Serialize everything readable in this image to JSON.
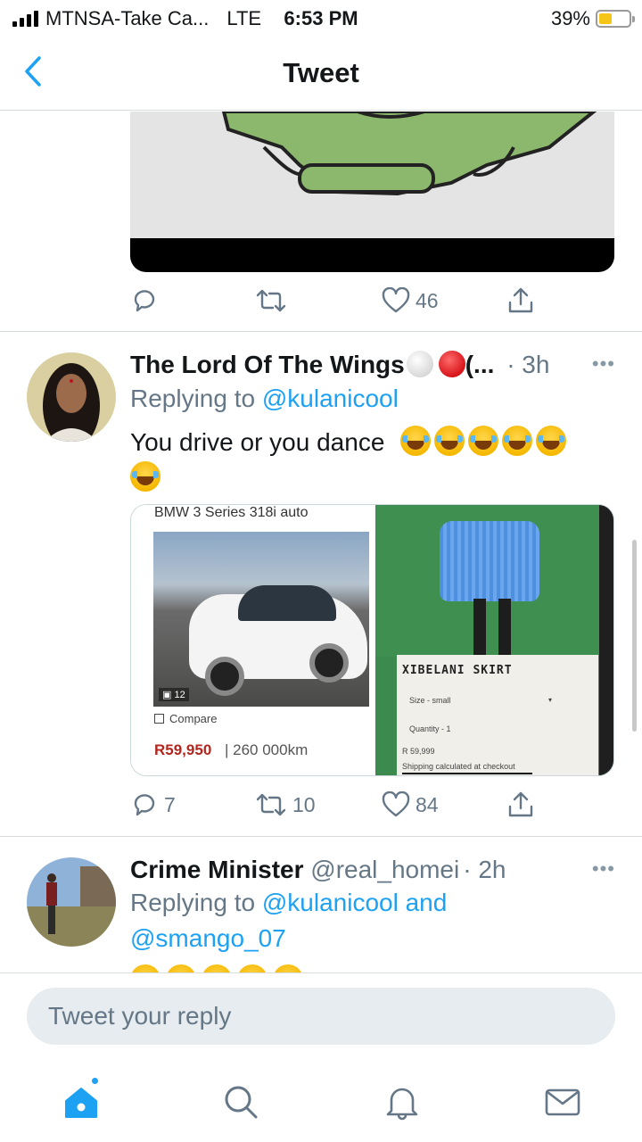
{
  "status_bar": {
    "carrier": "MTNSA-Take Ca...",
    "network": "LTE",
    "time": "6:53 PM",
    "battery_percent": "39%",
    "battery_level": 0.39
  },
  "nav": {
    "title": "Tweet"
  },
  "tweet1": {
    "likes": "46"
  },
  "tweet2": {
    "name": "The Lord Of The Wings",
    "name_suffix": "(...",
    "time": "· 3h",
    "replying_prefix": "Replying to ",
    "replying_to": "@kulanicool",
    "text": "You drive or you dance",
    "emoji_count": 6,
    "replies": "7",
    "retweets": "10",
    "likes": "84",
    "card_left": {
      "title": "BMW 3 Series 318i auto",
      "photo_count": "12",
      "compare": "Compare",
      "price": "R59,950",
      "mileage": "| 260 000km"
    },
    "card_right": {
      "title": "XIBELANI SKIRT",
      "size": "Size - small",
      "quantity": "Quantity - 1",
      "price": "R 59,999",
      "shipping": "Shipping calculated at checkout"
    }
  },
  "tweet3": {
    "name": "Crime Minister",
    "handle": "@real_homei",
    "time": "· 2h",
    "replying_prefix": "Replying to ",
    "replying_to_1": "@kulanicool",
    "and": " and",
    "replying_to_2": "@smango_07"
  },
  "reply": {
    "placeholder": "Tweet your reply"
  },
  "tabs": {
    "home": "home-icon",
    "search": "search-icon",
    "notifications": "bell-icon",
    "messages": "mail-icon"
  },
  "colors": {
    "accent": "#1da1f2",
    "secondary_text": "#657786"
  }
}
